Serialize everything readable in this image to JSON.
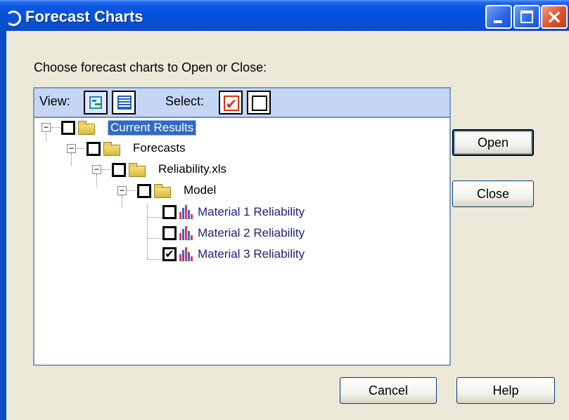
{
  "window": {
    "title": "Forecast Charts"
  },
  "prompt": "Choose forecast charts to Open or Close:",
  "toolbar": {
    "view_label": "View:",
    "select_label": "Select:"
  },
  "tree": {
    "root": {
      "label": "Current Results",
      "expanded": true,
      "checked": false,
      "selected": true
    },
    "forecasts": {
      "label": "Forecasts",
      "expanded": true,
      "checked": false
    },
    "workbook": {
      "label": "Reliability.xls",
      "expanded": true,
      "checked": false
    },
    "model": {
      "label": "Model",
      "expanded": true,
      "checked": false
    },
    "items": [
      {
        "label": "Material 1 Reliability",
        "checked": false
      },
      {
        "label": "Material 2 Reliability",
        "checked": false
      },
      {
        "label": "Material 3 Reliability",
        "checked": true
      }
    ]
  },
  "buttons": {
    "open": "Open",
    "close": "Close",
    "cancel": "Cancel",
    "help": "Help"
  },
  "glyphs": {
    "expander_minus": "−",
    "check": "✔",
    "close_x": "×"
  },
  "colors": {
    "titlebar": "#0552d8",
    "selection": "#316ac5",
    "dialog_bg": "#ece9d8",
    "toolbar_bg": "#c5d6f5",
    "select_all_check": "#e03010"
  }
}
